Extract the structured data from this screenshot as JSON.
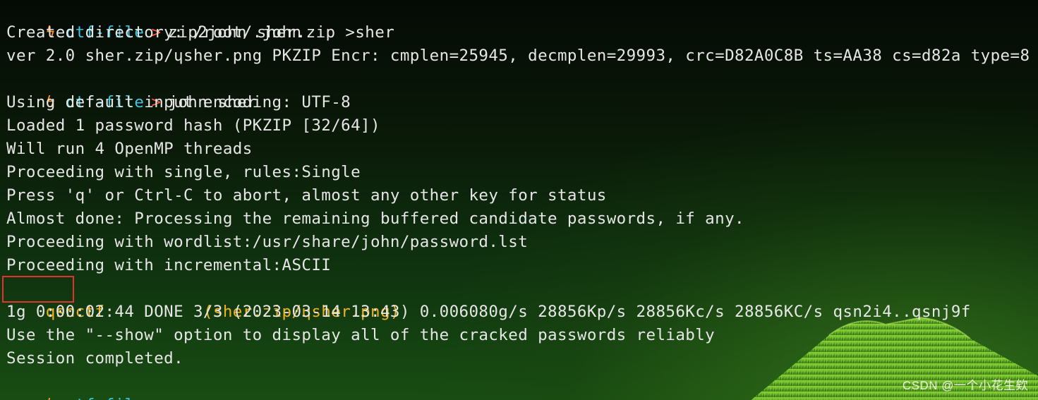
{
  "prompt": {
    "icon": "lightning-icon",
    "bolt_glyph": "ϟ",
    "dir": "ctf-file",
    "chevron": ">"
  },
  "lines": [
    {
      "type": "prompt",
      "cmd": "zip2john sher.zip >sher"
    },
    {
      "type": "text",
      "text": "Created directory: /root/.john"
    },
    {
      "type": "text",
      "text": "ver 2.0 sher.zip/ɥsher.png PKZIP Encr: cmplen=25945, decmplen=29993, crc=D82A0C8B ts=AA38 cs=d82a type=8"
    },
    {
      "type": "prompt",
      "cmd": "john sher"
    },
    {
      "type": "text",
      "text": "Using default input encoding: UTF-8"
    },
    {
      "type": "text",
      "text": "Loaded 1 password hash (PKZIP [32/64])"
    },
    {
      "type": "text",
      "text": "Will run 4 OpenMP threads"
    },
    {
      "type": "text",
      "text": "Proceeding with single, rules:Single"
    },
    {
      "type": "text",
      "text": "Press 'q' or Ctrl-C to abort, almost any other key for status"
    },
    {
      "type": "text",
      "text": "Almost done: Processing the remaining buffered candidate passwords, if any."
    },
    {
      "type": "text",
      "text": "Proceeding with wordlist:/usr/share/john/password.lst"
    },
    {
      "type": "text",
      "text": "Proceeding with incremental:ASCII"
    },
    {
      "type": "result",
      "password": "qsnctf",
      "spacer": "          ",
      "source": "(sher.zip/ɥsher.png)"
    },
    {
      "type": "text",
      "text": "1g 0:00:02:44 DONE 3/3 (2023-03-14 13:43) 0.006080g/s 28856Kp/s 28856Kc/s 28856KC/s qsn2i4..qsnj9f"
    },
    {
      "type": "text",
      "text": "Use the \"--show\" option to display all of the cracked passwords reliably"
    },
    {
      "type": "text",
      "text": "Session completed."
    },
    {
      "type": "prompt",
      "cmd": ""
    }
  ],
  "colors": {
    "prompt_icon": "#ff8c1a",
    "prompt_dir": "#3ec6e0",
    "prompt_chevron": "#ff5a3a",
    "output_text": "#e6e6e6",
    "cracked_password": "#f3b21c",
    "highlight_box": "#e3332e"
  },
  "watermark": "CSDN @一个小花生欸"
}
